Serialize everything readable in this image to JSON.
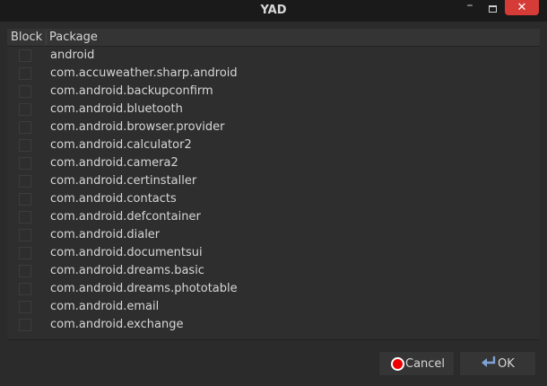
{
  "window": {
    "title": "YAD",
    "minimize_glyph": "–",
    "close_glyph": "✕"
  },
  "table": {
    "columns": [
      "Block",
      "Package"
    ],
    "rows": [
      {
        "block": false,
        "package": "android"
      },
      {
        "block": false,
        "package": "com.accuweather.sharp.android"
      },
      {
        "block": false,
        "package": "com.android.backupconfirm"
      },
      {
        "block": false,
        "package": "com.android.bluetooth"
      },
      {
        "block": false,
        "package": "com.android.browser.provider"
      },
      {
        "block": false,
        "package": "com.android.calculator2"
      },
      {
        "block": false,
        "package": "com.android.camera2"
      },
      {
        "block": false,
        "package": "com.android.certinstaller"
      },
      {
        "block": false,
        "package": "com.android.contacts"
      },
      {
        "block": false,
        "package": "com.android.defcontainer"
      },
      {
        "block": false,
        "package": "com.android.dialer"
      },
      {
        "block": false,
        "package": "com.android.documentsui"
      },
      {
        "block": false,
        "package": "com.android.dreams.basic"
      },
      {
        "block": false,
        "package": "com.android.dreams.phototable"
      },
      {
        "block": false,
        "package": "com.android.email"
      },
      {
        "block": false,
        "package": "com.android.exchange"
      }
    ]
  },
  "buttons": {
    "cancel_label": "Cancel",
    "ok_label": "OK"
  },
  "icons": {
    "cancel": "cancel-icon",
    "ok": "ok-icon"
  },
  "colors": {
    "close_button": "#d53b37",
    "cancel_icon": "#ee0000",
    "ok_icon": "#7fa3d6"
  }
}
